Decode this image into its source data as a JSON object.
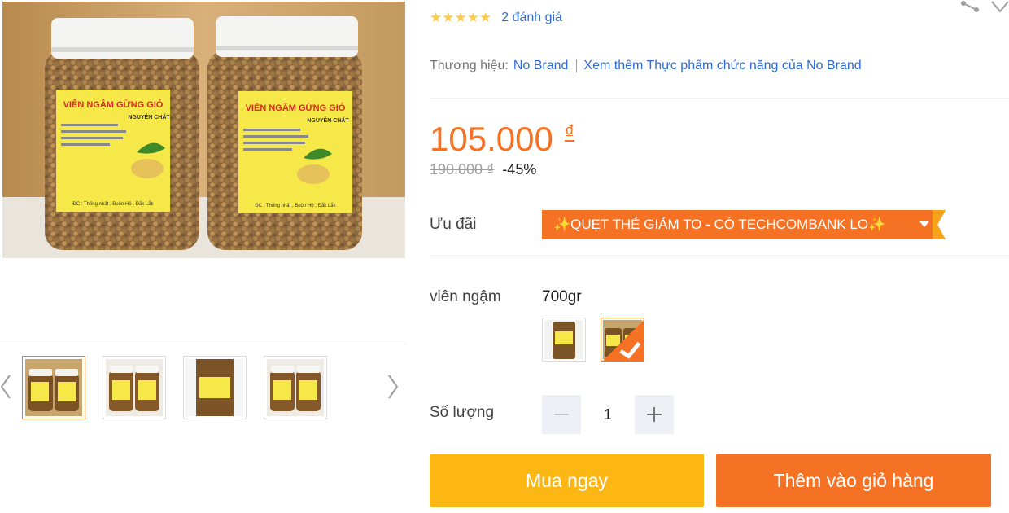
{
  "gallery": {
    "main_image_alt": "Viên ngậm gừng gió",
    "thumbnails": [
      {
        "name": "thumb-1",
        "active": true
      },
      {
        "name": "thumb-2",
        "active": false
      },
      {
        "name": "thumb-3",
        "active": false
      },
      {
        "name": "thumb-4",
        "active": false
      }
    ],
    "label_text": {
      "title": "VIÊN NGẬM GỪNG GIÓ",
      "subtitle": "NGUYÊN CHẤT",
      "ingredients": "THÀNH PHẦN: Gừng tươi 100%, đường phèn",
      "usage": "CÔNG DỤNG: Trị cảm cúm, chống lạnh bụng, đầy hơi, khó tiêu và chống ho, nhiễm lạnh, nôn ói, chống hạ đường huyết.",
      "nsx": "NSX:",
      "hsd": "HSD: 2 năm",
      "address": "ĐC : Thống nhất , Buôn Hồ , Đắk Lắk"
    }
  },
  "rating": {
    "stars": "★★★★★",
    "review_count_text": "2 đánh giá"
  },
  "brand": {
    "label": "Thương hiệu:",
    "name": "No Brand",
    "more_link": "Xem thêm Thực phẩm chức năng của No Brand"
  },
  "price": {
    "current": "105.000",
    "currency": "₫",
    "original": "190.000 ₫",
    "discount": "-45%"
  },
  "promo": {
    "label": "Ưu đãi",
    "banner_text": "✨QUẸT THẺ GIẢM TO - CÓ TECHCOMBANK LO✨",
    "color": "#f57224"
  },
  "variant": {
    "label": "viên ngậm",
    "selected_value": "700gr"
  },
  "quantity": {
    "label": "Số lượng",
    "value": "1"
  },
  "actions": {
    "buy_now": "Mua ngay",
    "add_to_cart": "Thêm vào giỏ hàng"
  },
  "colors": {
    "accent": "#f57224",
    "buy_button": "#fcb714",
    "link": "#2e6bd6",
    "star": "#faca51"
  }
}
